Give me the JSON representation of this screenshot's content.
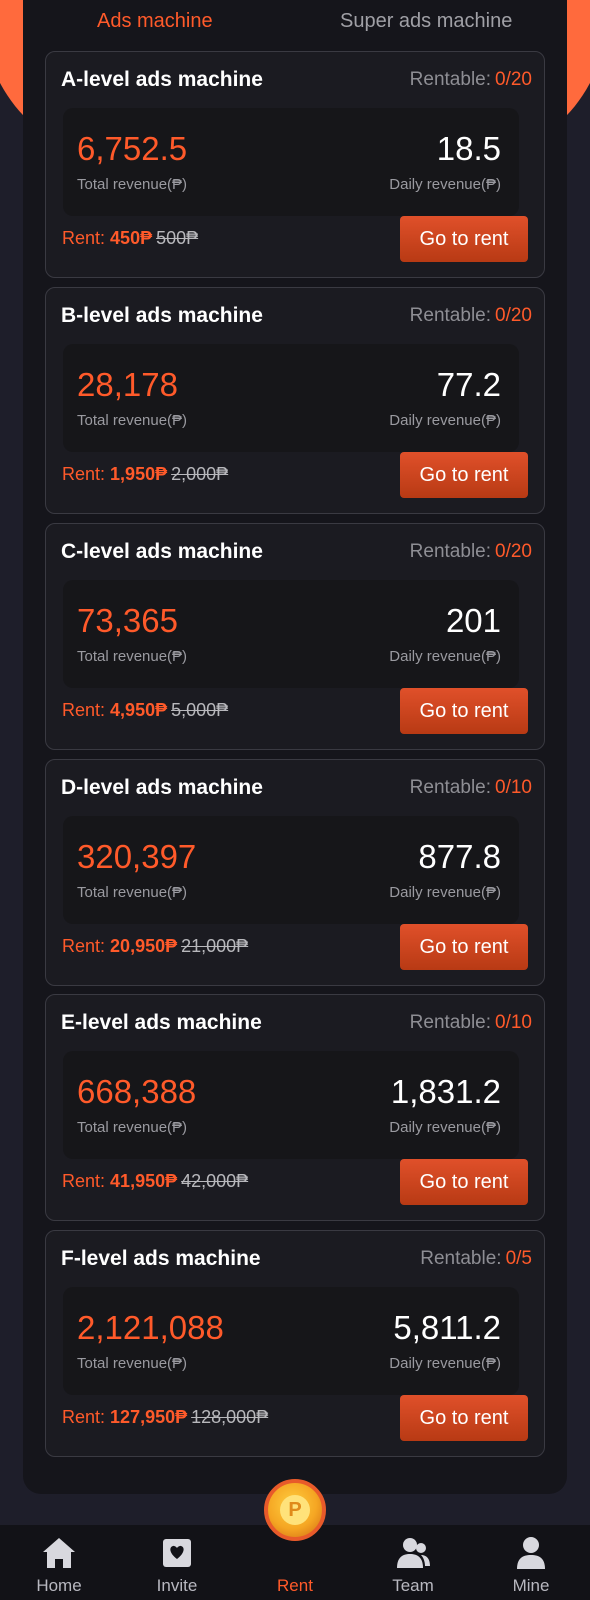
{
  "tabs": {
    "active": "Ads machine",
    "inactive": "Super ads machine"
  },
  "labels": {
    "rentable": "Rentable:",
    "total_revenue": "Total revenue(₱)",
    "daily_revenue": "Daily revenue(₱)",
    "rent_prefix": "Rent:",
    "go_to_rent": "Go to rent"
  },
  "machines": [
    {
      "title": "A-level ads machine",
      "rentable": "0/20",
      "total": "6,752.5",
      "daily": "18.5",
      "price": "450₱",
      "old_price": "500₱"
    },
    {
      "title": "B-level ads machine",
      "rentable": "0/20",
      "total": "28,178",
      "daily": "77.2",
      "price": "1,950₱",
      "old_price": "2,000₱"
    },
    {
      "title": "C-level ads machine",
      "rentable": "0/20",
      "total": "73,365",
      "daily": "201",
      "price": "4,950₱",
      "old_price": "5,000₱"
    },
    {
      "title": "D-level ads machine",
      "rentable": "0/10",
      "total": "320,397",
      "daily": "877.8",
      "price": "20,950₱",
      "old_price": "21,000₱"
    },
    {
      "title": "E-level ads machine",
      "rentable": "0/10",
      "total": "668,388",
      "daily": "1,831.2",
      "price": "41,950₱",
      "old_price": "42,000₱"
    },
    {
      "title": "F-level ads machine",
      "rentable": "0/5",
      "total": "2,121,088",
      "daily": "5,811.2",
      "price": "127,950₱",
      "old_price": "128,000₱"
    }
  ],
  "nav": [
    {
      "label": "Home",
      "icon": "home-icon"
    },
    {
      "label": "Invite",
      "icon": "invite-icon"
    },
    {
      "label": "Rent",
      "icon": "rent-coin-icon"
    },
    {
      "label": "Team",
      "icon": "team-icon"
    },
    {
      "label": "Mine",
      "icon": "user-icon"
    }
  ],
  "colors": {
    "accent": "#ff5a2a",
    "background": "#1e1e2a",
    "card": "#1b1b21"
  }
}
